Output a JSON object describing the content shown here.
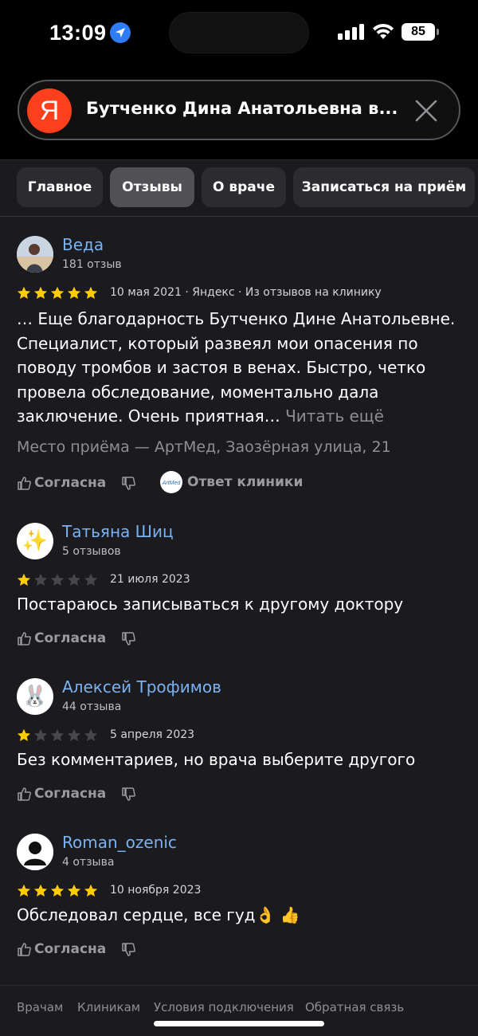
{
  "status": {
    "time": "13:09",
    "battery": "85"
  },
  "search": {
    "query": "Бутченко Дина Анатольевна в...",
    "logo_letter": "Я"
  },
  "tabs": [
    {
      "label": "Главное",
      "active": false
    },
    {
      "label": "Отзывы",
      "active": true
    },
    {
      "label": "О враче",
      "active": false
    },
    {
      "label": "Записаться на приём",
      "active": false
    }
  ],
  "reviews": [
    {
      "author": "Веда",
      "count": "181 отзыв",
      "rating": 5,
      "date": "10 мая 2021",
      "source": " · Яндекс · Из отзывов на клинику",
      "text": "… Еще благодарность Бутченко Дине Анатольевне. Специалист, который развеял мои опасения по поводу тромбов и застоя в венах. Быстро, четко провела обследование, моментально дала заключение. Очень приятная…",
      "read_more": "Читать ещё",
      "place": "Место приёма — АртМед, Заозёрная улица, 21",
      "agree_label": "Согласна",
      "clinic_reply_label": "Ответ клиники"
    },
    {
      "author": "Татьяна Шиц",
      "count": "5 отзывов",
      "rating": 1,
      "date": "21 июля 2023",
      "avatar_emoji": "✨",
      "text": "Постараюсь записываться к другому доктору",
      "agree_label": "Согласна"
    },
    {
      "author": "Алексей Трофимов",
      "count": "44 отзыва",
      "rating": 1,
      "date": "5 апреля 2023",
      "avatar_emoji": "🐰",
      "text": "Без комментариев, но врача выберите другого",
      "agree_label": "Согласна"
    },
    {
      "author": "Roman_ozenic",
      "count": "4 отзыва",
      "rating": 5,
      "date": "10 ноября 2023",
      "text": "Обследовал сердце, все гуд👌 👍",
      "agree_label": "Согласна"
    }
  ],
  "footer": {
    "links": [
      "Врачам",
      "Клиникам",
      "Условия подключения",
      "Обратная связь"
    ]
  },
  "colors": {
    "star_filled": "#ffcc00",
    "star_empty": "#47464b",
    "author_link": "#7ab3f2",
    "yandex_red": "#fc3f1d"
  }
}
